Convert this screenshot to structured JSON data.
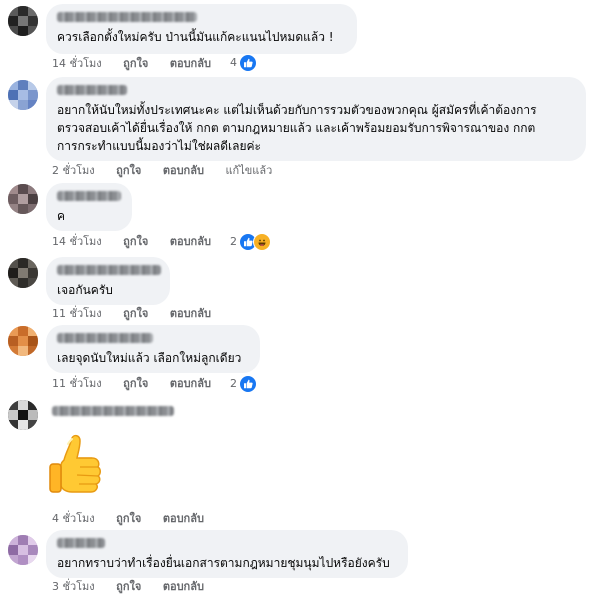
{
  "comments": [
    {
      "text": "ควรเลือกตั้งใหม่ครับ ป่านนี้มันแก้คะแนนไปหมดแล้ว !",
      "time": "14 ชั่วโมง",
      "like": "ถูกใจ",
      "reply": "ตอบกลับ",
      "reaction_count": "4",
      "reactions": [
        "like-icon"
      ]
    },
    {
      "text": "อยากให้นับใหม่ทั้งประเทศนะคะ แต่ไม่เห็นด้วยกับการรวมตัวของพวกคุณ ผู้สมัครที่เค้าต้องการ\nตรวจสอบเค้าได้ยื่นเรื่องให้ กกต ตามกฎหมายแล้ว และเค้าพร้อมยอมรับการพิจารณาของ กกต\nการกระทำแบบนี้มองว่าไม่ใช่ผลดีเลยค่ะ",
      "time": "2 ชั่วโมง",
      "like": "ถูกใจ",
      "reply": "ตอบกลับ",
      "edited": "แก้ไขแล้ว"
    },
    {
      "text": "ค",
      "time": "14 ชั่วโมง",
      "like": "ถูกใจ",
      "reply": "ตอบกลับ",
      "reaction_count": "2",
      "reactions": [
        "like-icon",
        "haha-icon"
      ]
    },
    {
      "text": "เจอกันครับ",
      "time": "11 ชั่วโมง",
      "like": "ถูกใจ",
      "reply": "ตอบกลับ"
    },
    {
      "text": "เลยจุดนับใหม่แล้ว เลือกใหม่ลูกเดียว",
      "time": "11 ชั่วโมง",
      "like": "ถูกใจ",
      "reply": "ตอบกลับ",
      "reaction_count": "2",
      "reactions": [
        "like-icon"
      ]
    },
    {
      "sticker": "thumbs-up-sticker",
      "time": "4 ชั่วโมง",
      "like": "ถูกใจ",
      "reply": "ตอบกลับ"
    },
    {
      "text": "อยากทราบว่าทำเรื่องยื่นเอกสารตามกฎหมายชุมนุมไปหรือยังครับ",
      "time": "3 ชั่วโมง",
      "like": "ถูกใจ",
      "reply": "ตอบกลับ"
    }
  ],
  "colors": {
    "bubble": "#f0f2f5",
    "meta_text": "#65676b",
    "like_blue": "#1877f2",
    "haha_yellow": "#f7b125"
  }
}
